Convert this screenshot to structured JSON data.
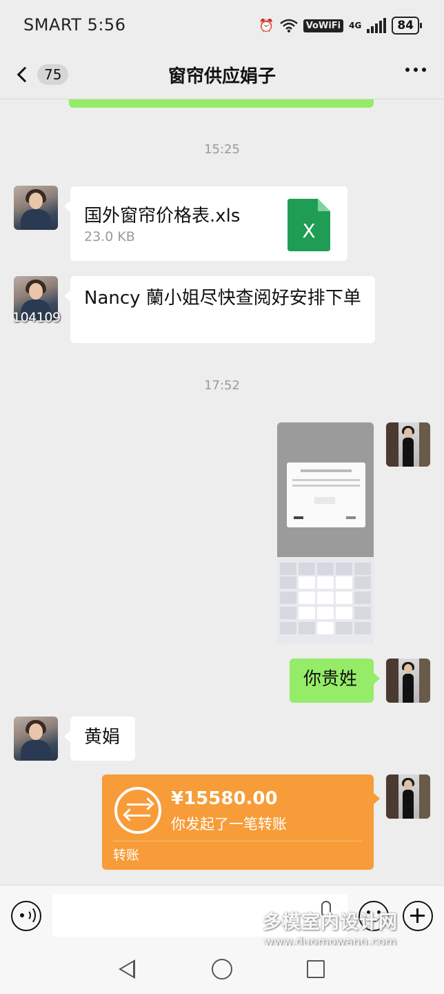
{
  "status_bar": {
    "carrier_time": "SMART 5:56",
    "vowifi": "VoWiFi",
    "network": "4G",
    "battery": "84"
  },
  "header": {
    "back_count": "75",
    "title": "窗帘供应娟子"
  },
  "messages": {
    "timestamp_1": "15:25",
    "file": {
      "name": "国外窗帘价格表.xls",
      "size": "23.0 KB",
      "icon_letter": "X"
    },
    "text_1": "Nancy 蘭小姐尽快查阅好安排下单",
    "avatar_tag": "104109",
    "timestamp_2": "17:52",
    "text_2": "你贵姓",
    "text_3": "黄娟",
    "transfer": {
      "amount": "¥15580.00",
      "description": "你发起了一笔转账",
      "label": "转账"
    }
  },
  "input_bar": {
    "placeholder": ""
  },
  "watermark": {
    "name": "多模室内设计网",
    "url": "www.duomowang.com"
  },
  "colors": {
    "chat_bg": "#ededed",
    "sent_bubble": "#95ec69",
    "transfer_card": "#f79c38",
    "excel_green": "#1f9d55"
  }
}
